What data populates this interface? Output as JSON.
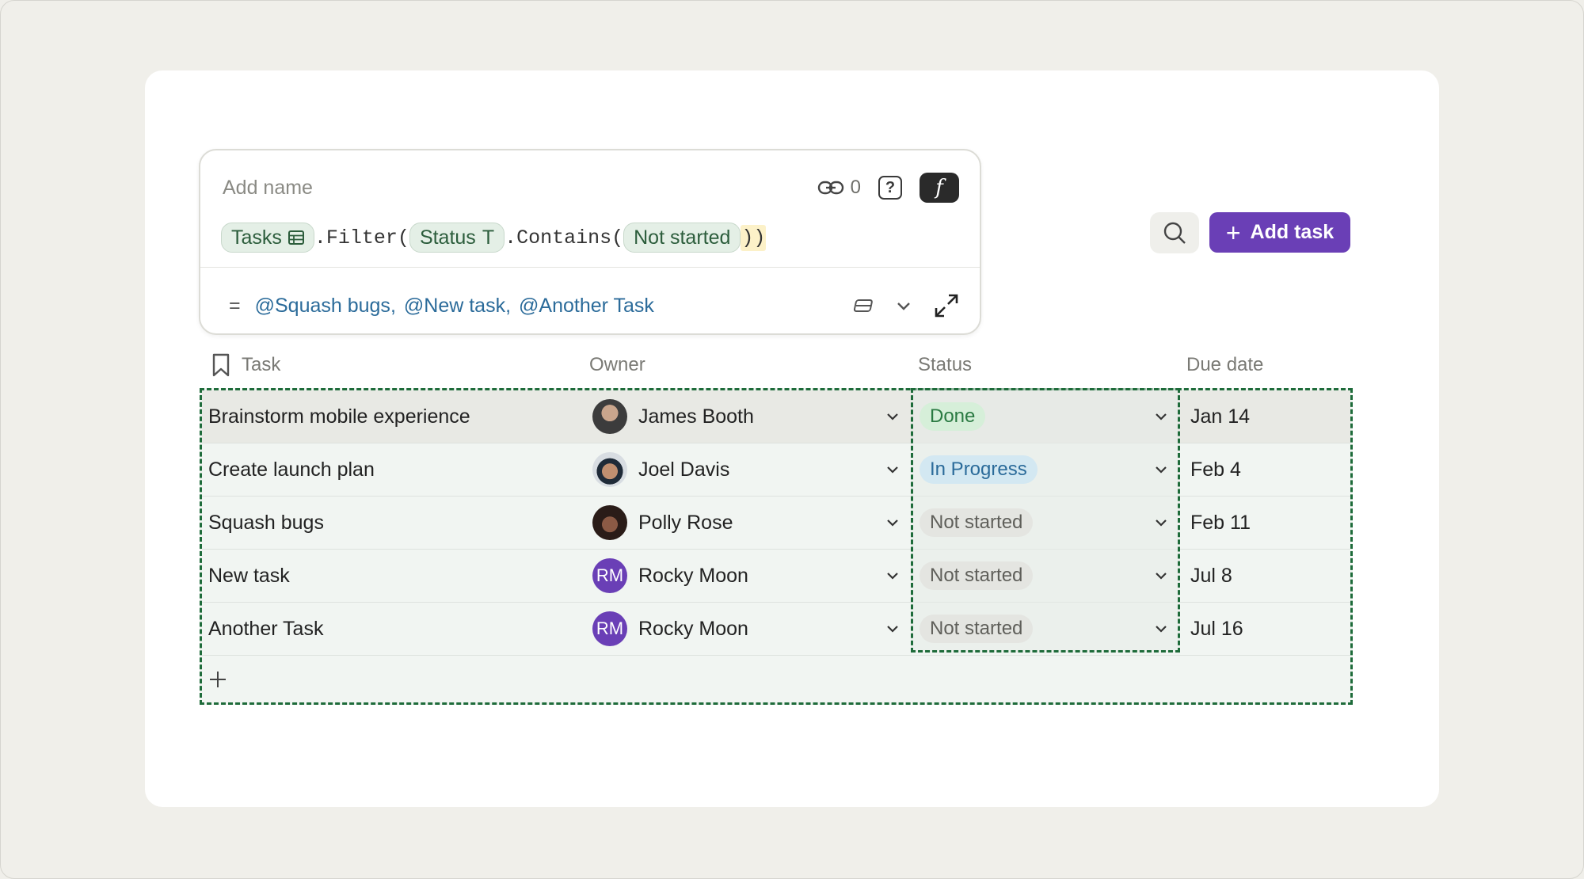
{
  "formula": {
    "name_placeholder": "Add name",
    "link_count": "0",
    "help_label": "?",
    "fx_label": "f",
    "expression": {
      "table_chip": "Tasks",
      "filter_text": ".Filter(",
      "status_chip": "Status",
      "status_type_icon": "T",
      "contains_text": ".Contains(",
      "value_chip": "Not started",
      "close_text": "))"
    },
    "result": {
      "equals": "=",
      "mentions": [
        "@Squash bugs",
        "@New task",
        "@Another Task"
      ],
      "separator": ","
    }
  },
  "toolbar": {
    "add_task_label": "Add task",
    "add_task_plus": "+"
  },
  "table": {
    "columns": [
      "Task",
      "Owner",
      "Status",
      "Due date"
    ],
    "rows": [
      {
        "task": "Brainstorm mobile experience",
        "owner": "James Booth",
        "avatar": "",
        "status": "Done",
        "due": "Jan 14"
      },
      {
        "task": "Create launch plan",
        "owner": "Joel Davis",
        "avatar": "",
        "status": "In Progress",
        "due": "Feb 4"
      },
      {
        "task": "Squash bugs",
        "owner": "Polly Rose",
        "avatar": "",
        "status": "Not started",
        "due": "Feb 11"
      },
      {
        "task": "New task",
        "owner": "Rocky Moon",
        "avatar": "RM",
        "status": "Not started",
        "due": "Jul 8"
      },
      {
        "task": "Another Task",
        "owner": "Rocky Moon",
        "avatar": "RM",
        "status": "Not started",
        "due": "Jul 16"
      }
    ],
    "add_row_label": "+"
  },
  "colors": {
    "accent": "#6a3fb6",
    "selection_border": "#1e6b3a",
    "done": "#d6efd9",
    "in_progress": "#d3e8f2",
    "not_started": "#e4e5e1"
  },
  "icons": [
    "link-icon",
    "help-icon",
    "formula-icon",
    "table-icon",
    "text-type-icon",
    "format-icon",
    "chevron-down-icon",
    "expand-icon",
    "search-icon",
    "bookmark-icon",
    "plus-icon"
  ]
}
